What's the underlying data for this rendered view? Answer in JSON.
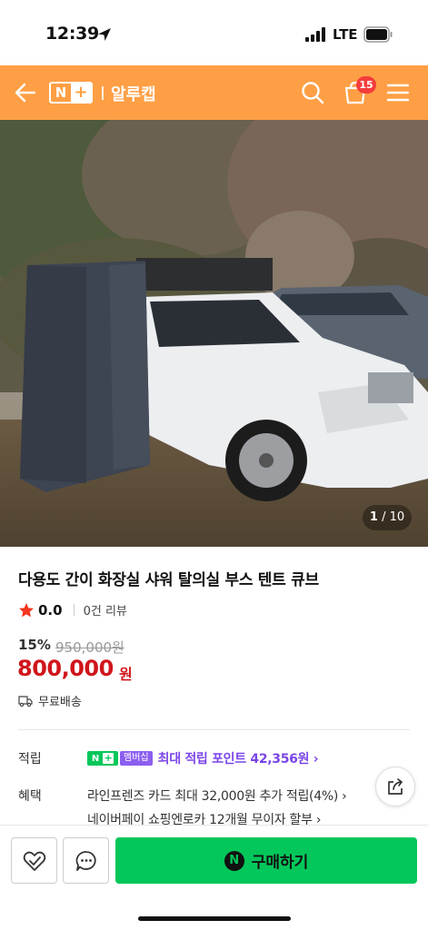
{
  "status_bar": {
    "time": "12:39",
    "network": "LTE"
  },
  "header": {
    "logo_n": "N",
    "logo_plus": "+",
    "store_name": "알루캡",
    "cart_count": "15",
    "bg_color": "#ff9f45"
  },
  "gallery": {
    "current": "1",
    "total": "/ 10"
  },
  "product": {
    "title": "다용도 간이 화장실 샤워 탈의실 부스 텐트 큐브",
    "rating": "0.0",
    "review_count": "0건 리뷰",
    "discount": "15%",
    "original_price": "950,000원",
    "price": "800,000",
    "price_unit": "원",
    "shipping": "무료배송"
  },
  "details": {
    "points_label": "적립",
    "membership_n": "N",
    "membership_plus": "+",
    "membership_tag": "멤버십",
    "points_text": "최대 적립 포인트 42,356원 ›",
    "benefit_label": "혜택",
    "benefits": [
      "라인프렌즈 카드 최대 32,000원 추가 적립(4%) ›",
      "네이버페이 쇼핑엔로카 12개월 무이자 할부 ›"
    ]
  },
  "bottom_bar": {
    "buy_logo": "N",
    "buy_label": "구매하기",
    "buy_color": "#03c75a"
  },
  "icons": [
    "location-arrow-icon",
    "signal-icon",
    "battery-icon",
    "back-arrow-icon",
    "search-icon",
    "cart-icon",
    "menu-icon",
    "star-icon",
    "truck-icon",
    "share-icon",
    "heart-check-icon",
    "chat-icon"
  ]
}
